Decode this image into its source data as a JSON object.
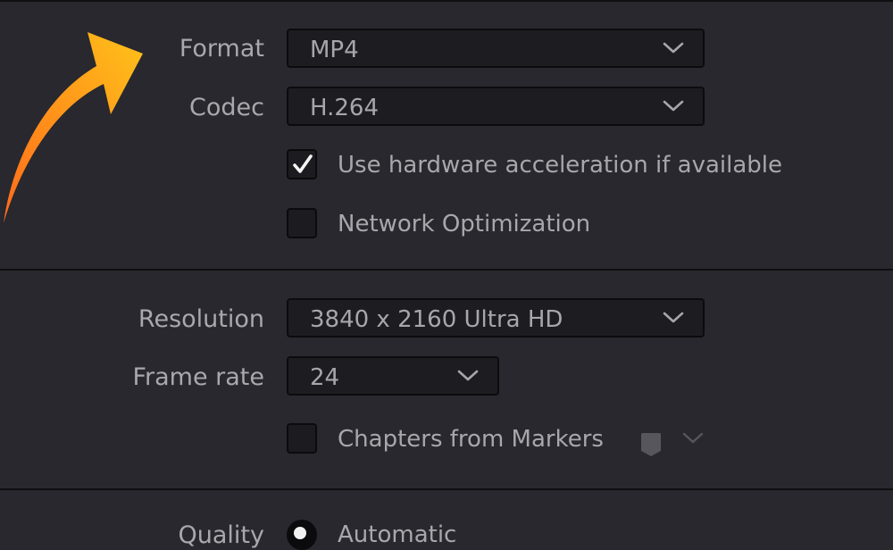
{
  "format": {
    "label": "Format",
    "value": "MP4"
  },
  "codec": {
    "label": "Codec",
    "value": "H.264"
  },
  "hardware_acceleration": {
    "label": "Use hardware acceleration if available",
    "checked": true
  },
  "network_optimization": {
    "label": "Network Optimization",
    "checked": false
  },
  "resolution": {
    "label": "Resolution",
    "value": "3840 x 2160 Ultra HD"
  },
  "frame_rate": {
    "label": "Frame rate",
    "value": "24"
  },
  "chapters_from_markers": {
    "label": "Chapters from Markers",
    "checked": false
  },
  "quality": {
    "label": "Quality",
    "option_label": "Automatic",
    "selected": true
  },
  "colors": {
    "background": "#28282e",
    "field": "#1d1d21",
    "text": "#a8a8ad",
    "arrow_start": "#ff6a1a",
    "arrow_end": "#ffc21a"
  },
  "icons": {
    "dropdown": "chevron-down-icon",
    "checked": "checkmark-icon",
    "marker": "marker-tag-icon",
    "annotation": "curved-arrow-icon"
  }
}
